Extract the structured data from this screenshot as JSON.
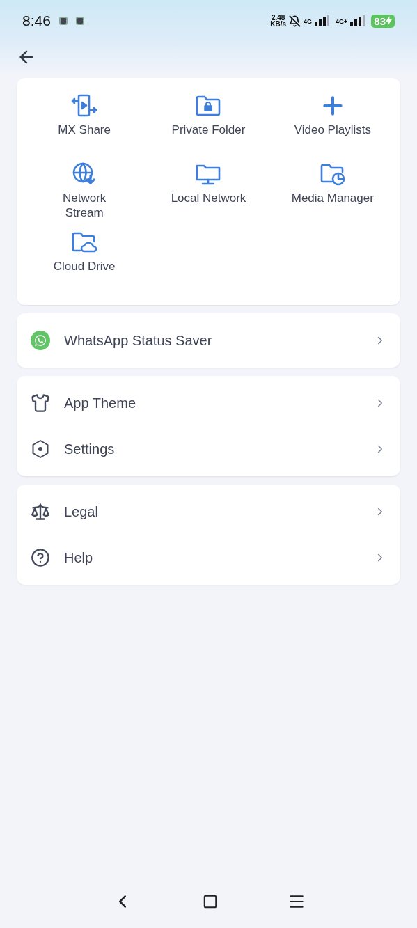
{
  "status_bar": {
    "time": "8:46",
    "speed": "2.48",
    "speed_unit": "KB/s",
    "network_1": "4G",
    "network_2": "4G+",
    "battery": "83"
  },
  "shortcuts": [
    {
      "label": "MX Share",
      "kind": "share"
    },
    {
      "label": "Private Folder",
      "kind": "lock-folder"
    },
    {
      "label": "Video Playlists",
      "kind": "plus"
    },
    {
      "label": "Network\nStream",
      "kind": "globe"
    },
    {
      "label": "Local Network",
      "kind": "monitor"
    },
    {
      "label": "Media Manager",
      "kind": "chart-folder"
    },
    {
      "label": "Cloud Drive",
      "kind": "cloud-folder"
    }
  ],
  "menu_groups": [
    [
      {
        "label": "WhatsApp Status Saver",
        "kind": "whatsapp"
      }
    ],
    [
      {
        "label": "App Theme",
        "kind": "shirt"
      },
      {
        "label": "Settings",
        "kind": "hexagon"
      }
    ],
    [
      {
        "label": "Legal",
        "kind": "scale"
      },
      {
        "label": "Help",
        "kind": "help"
      }
    ]
  ]
}
